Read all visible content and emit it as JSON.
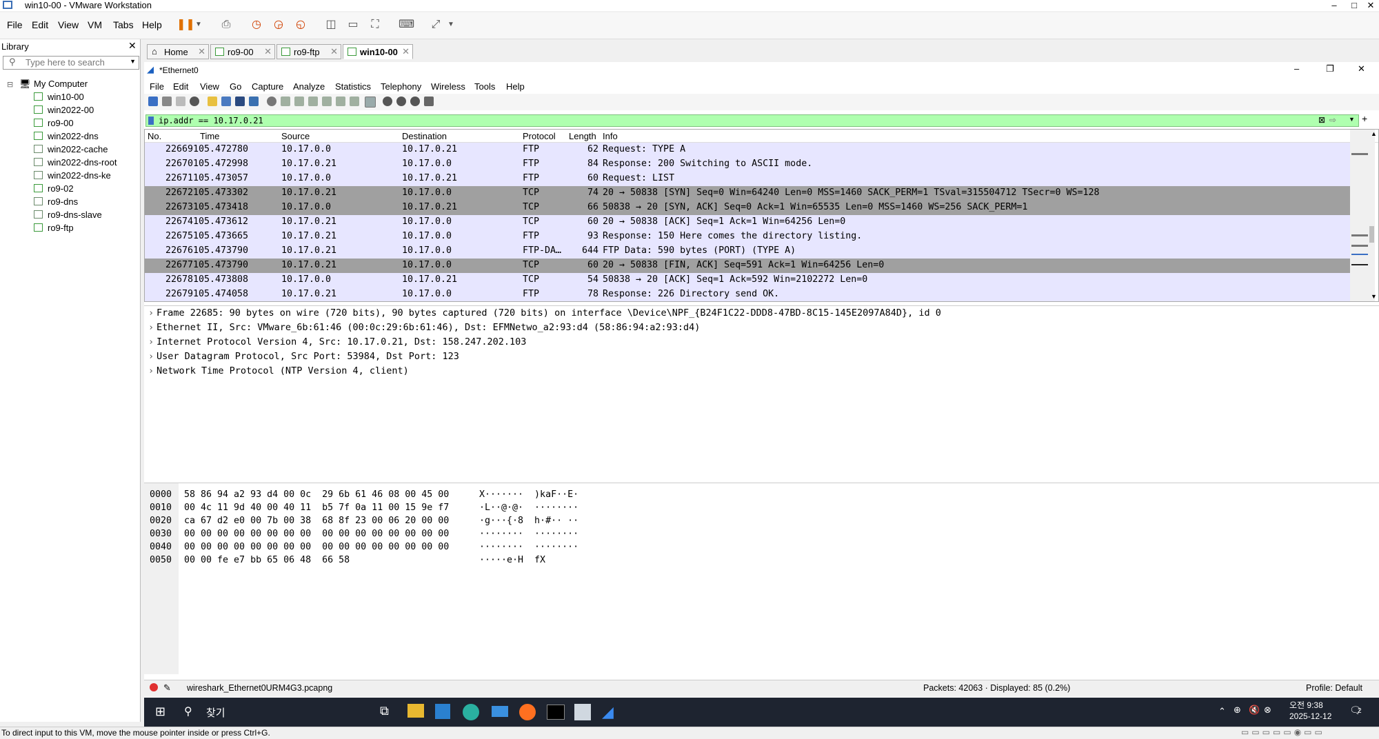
{
  "vmware": {
    "title": "win10-00 - VMware Workstation",
    "menu": [
      "File",
      "Edit",
      "View",
      "VM",
      "Tabs",
      "Help"
    ],
    "window_controls": {
      "min": "–",
      "max": "□",
      "close": "✕"
    }
  },
  "library": {
    "title": "Library",
    "close": "✕",
    "search_placeholder": "Type here to search",
    "root": "My Computer",
    "items": [
      "win10-00",
      "win2022-00",
      "ro9-00",
      "win2022-dns",
      "win2022-cache",
      "win2022-dns-root",
      "win2022-dns-ke",
      "ro9-02",
      "ro9-dns",
      "ro9-dns-slave",
      "ro9-ftp"
    ]
  },
  "vm_tabs": [
    {
      "label": "Home"
    },
    {
      "label": "ro9-00"
    },
    {
      "label": "ro9-ftp"
    },
    {
      "label": "win10-00"
    }
  ],
  "wireshark": {
    "title": "*Ethernet0",
    "window_controls": {
      "min": "–",
      "max": "❐",
      "close": "✕"
    },
    "menu": [
      "File",
      "Edit",
      "View",
      "Go",
      "Capture",
      "Analyze",
      "Statistics",
      "Telephony",
      "Wireless",
      "Tools",
      "Help"
    ],
    "filter": "ip.addr == 10.17.0.21",
    "columns": [
      "No.",
      "Time",
      "Source",
      "Destination",
      "Protocol",
      "Length",
      "Info"
    ],
    "packets": [
      {
        "no": "22669",
        "time": "105.472780",
        "src": "10.17.0.0",
        "dst": "10.17.0.21",
        "proto": "FTP",
        "len": "62",
        "info": "Request: TYPE A"
      },
      {
        "no": "22670",
        "time": "105.472998",
        "src": "10.17.0.21",
        "dst": "10.17.0.0",
        "proto": "FTP",
        "len": "84",
        "info": "Response: 200 Switching to ASCII mode."
      },
      {
        "no": "22671",
        "time": "105.473057",
        "src": "10.17.0.0",
        "dst": "10.17.0.21",
        "proto": "FTP",
        "len": "60",
        "info": "Request: LIST"
      },
      {
        "no": "22672",
        "time": "105.473302",
        "src": "10.17.0.21",
        "dst": "10.17.0.0",
        "proto": "TCP",
        "len": "74",
        "info": "20 → 50838 [SYN] Seq=0 Win=64240 Len=0 MSS=1460 SACK_PERM=1 TSval=315504712 TSecr=0 WS=128"
      },
      {
        "no": "22673",
        "time": "105.473418",
        "src": "10.17.0.0",
        "dst": "10.17.0.21",
        "proto": "TCP",
        "len": "66",
        "info": "50838 → 20 [SYN, ACK] Seq=0 Ack=1 Win=65535 Len=0 MSS=1460 WS=256 SACK_PERM=1"
      },
      {
        "no": "22674",
        "time": "105.473612",
        "src": "10.17.0.21",
        "dst": "10.17.0.0",
        "proto": "TCP",
        "len": "60",
        "info": "20 → 50838 [ACK] Seq=1 Ack=1 Win=64256 Len=0"
      },
      {
        "no": "22675",
        "time": "105.473665",
        "src": "10.17.0.21",
        "dst": "10.17.0.0",
        "proto": "FTP",
        "len": "93",
        "info": "Response: 150 Here comes the directory listing."
      },
      {
        "no": "22676",
        "time": "105.473790",
        "src": "10.17.0.21",
        "dst": "10.17.0.0",
        "proto": "FTP-DA…",
        "len": "644",
        "info": "FTP Data: 590 bytes (PORT) (TYPE A)"
      },
      {
        "no": "22677",
        "time": "105.473790",
        "src": "10.17.0.21",
        "dst": "10.17.0.0",
        "proto": "TCP",
        "len": "60",
        "info": "20 → 50838 [FIN, ACK] Seq=591 Ack=1 Win=64256 Len=0"
      },
      {
        "no": "22678",
        "time": "105.473808",
        "src": "10.17.0.0",
        "dst": "10.17.0.21",
        "proto": "TCP",
        "len": "54",
        "info": "50838 → 20 [ACK] Seq=1 Ack=592 Win=2102272 Len=0"
      },
      {
        "no": "22679",
        "time": "105.474058",
        "src": "10.17.0.21",
        "dst": "10.17.0.0",
        "proto": "FTP",
        "len": "78",
        "info": "Response: 226 Directory send OK."
      }
    ],
    "details": [
      "Frame 22685: 90 bytes on wire (720 bits), 90 bytes captured (720 bits) on interface \\Device\\NPF_{B24F1C22-DDD8-47BD-8C15-145E2097A84D}, id 0",
      "Ethernet II, Src: VMware_6b:61:46 (00:0c:29:6b:61:46), Dst: EFMNetwo_a2:93:d4 (58:86:94:a2:93:d4)",
      "Internet Protocol Version 4, Src: 10.17.0.21, Dst: 158.247.202.103",
      "User Datagram Protocol, Src Port: 53984, Dst Port: 123",
      "Network Time Protocol (NTP Version 4, client)"
    ],
    "hex": [
      {
        "off": "0000",
        "bytes": "58 86 94 a2 93 d4 00 0c  29 6b 61 46 08 00 45 00",
        "ascii": "X·······  )kaF··E·"
      },
      {
        "off": "0010",
        "bytes": "00 4c 11 9d 40 00 40 11  b5 7f 0a 11 00 15 9e f7",
        "ascii": "·L··@·@·  ········"
      },
      {
        "off": "0020",
        "bytes": "ca 67 d2 e0 00 7b 00 38  68 8f 23 00 06 20 00 00",
        "ascii": "·g···{·8  h·#·· ··"
      },
      {
        "off": "0030",
        "bytes": "00 00 00 00 00 00 00 00  00 00 00 00 00 00 00 00",
        "ascii": "········  ········"
      },
      {
        "off": "0040",
        "bytes": "00 00 00 00 00 00 00 00  00 00 00 00 00 00 00 00",
        "ascii": "········  ········"
      },
      {
        "off": "0050",
        "bytes": "00 00 fe e7 bb 65 06 48  66 58",
        "ascii": "·····e·H  fX"
      }
    ],
    "status": {
      "file": "wireshark_Ethernet0URM4G3.pcapng",
      "packets": "Packets: 42063 · Displayed: 85 (0.2%)",
      "profile": "Profile: Default"
    }
  },
  "taskbar": {
    "search": "찾기",
    "time": "오전 9:38",
    "date": "2025-12-12",
    "notif": "2"
  },
  "vm_status": "To direct input to this VM, move the mouse pointer inside or press Ctrl+G.",
  "colors": {
    "accent": "#0078d7",
    "filter_bg": "#afffaf",
    "row_bg": "#e7e6ff",
    "row_dark": "#a0a0a0",
    "taskbar": "#1e2430"
  }
}
